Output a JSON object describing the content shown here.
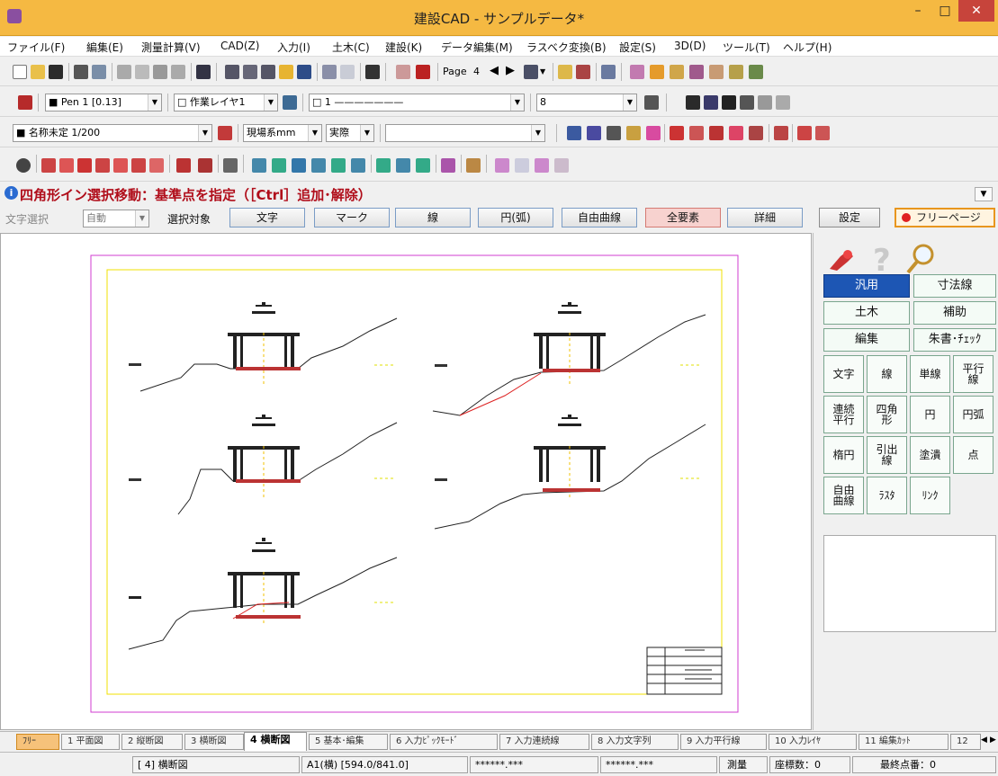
{
  "window": {
    "title": "建設CAD - サンプルデータ*"
  },
  "menu": [
    {
      "label": "ファイル(F)"
    },
    {
      "label": "編集(E)"
    },
    {
      "label": "測量計算(V)"
    },
    {
      "label": "CAD(Z)"
    },
    {
      "label": "入力(I)"
    },
    {
      "label": "土木(C)"
    },
    {
      "label": "建設(K)"
    },
    {
      "label": "データ編集(M)"
    },
    {
      "label": "ラスベク変換(B)"
    },
    {
      "label": "設定(S)"
    },
    {
      "label": "3D(D)"
    },
    {
      "label": "ツール(T)"
    },
    {
      "label": "ヘルプ(H)"
    }
  ],
  "toolbar1": {
    "page_label": "Page",
    "page_number": "4"
  },
  "toolbar2": {
    "pen_value": "■ Pen 1 [0.13]",
    "layer_value": "□ 作業レイヤ1",
    "linetype_value": "□ 1 ———————",
    "linewidth_value": "8"
  },
  "toolbar3": {
    "scale_value": "■ 名称未定 1/200",
    "coord_system_value": "現場系mm",
    "mode_value": "実際",
    "text_value": ""
  },
  "status_message": "四角形イン選択移動：基準点を指定（［Ctrl］追加･解除）",
  "selection_bar": {
    "text_select_label": "文字選択",
    "text_select_value": "自動",
    "target_label": "選択対象",
    "buttons": [
      {
        "label": "文字"
      },
      {
        "label": "マーク"
      },
      {
        "label": "線"
      },
      {
        "label": "円(弧)"
      },
      {
        "label": "自由曲線"
      },
      {
        "label": "全要素"
      },
      {
        "label": "詳細"
      }
    ],
    "settings_label": "設定",
    "free_page_label": "フリーページ"
  },
  "right_panel": {
    "categories": [
      {
        "label": "汎用"
      },
      {
        "label": "寸法線"
      },
      {
        "label": "土木"
      },
      {
        "label": "補助"
      },
      {
        "label": "編集"
      },
      {
        "label": "朱書･ﾁｪｯｸ"
      }
    ],
    "tools": [
      {
        "label": "文字"
      },
      {
        "label": "線"
      },
      {
        "label": "単線"
      },
      {
        "label": "平行\n線"
      },
      {
        "label": "連続\n平行"
      },
      {
        "label": "四角\n形"
      },
      {
        "label": "円"
      },
      {
        "label": "円弧"
      },
      {
        "label": "楕円"
      },
      {
        "label": "引出\n線"
      },
      {
        "label": "塗潰"
      },
      {
        "label": "点"
      },
      {
        "label": "自由\n曲線"
      },
      {
        "label": "ﾗｽﾀ"
      },
      {
        "label": "ﾘﾝｸ"
      }
    ]
  },
  "tabs": [
    {
      "label": "ﾌﾘｰ"
    },
    {
      "label": "1 平面図"
    },
    {
      "label": "2 縦断図"
    },
    {
      "label": "3 横断図"
    },
    {
      "label": "4 横断図"
    },
    {
      "label": "5 基本･編集"
    },
    {
      "label": "6 入力ﾋﾟｯｸﾓｰﾄﾞ"
    },
    {
      "label": "7 入力連続線"
    },
    {
      "label": "8 入力文字列"
    },
    {
      "label": "9 入力平行線"
    },
    {
      "label": "10 入力ﾚｲﾔ"
    },
    {
      "label": "11 編集ｶｯﾄ"
    },
    {
      "label": "12"
    }
  ],
  "statusbar": {
    "sheet": "[ 4] 横断図",
    "paper": "A1(横) [594.0/841.0]",
    "coord_x": "******.***",
    "coord_y": "******.***",
    "mode": "測量",
    "coord_count": "座標数：0",
    "last_point": "最終点番：0"
  }
}
